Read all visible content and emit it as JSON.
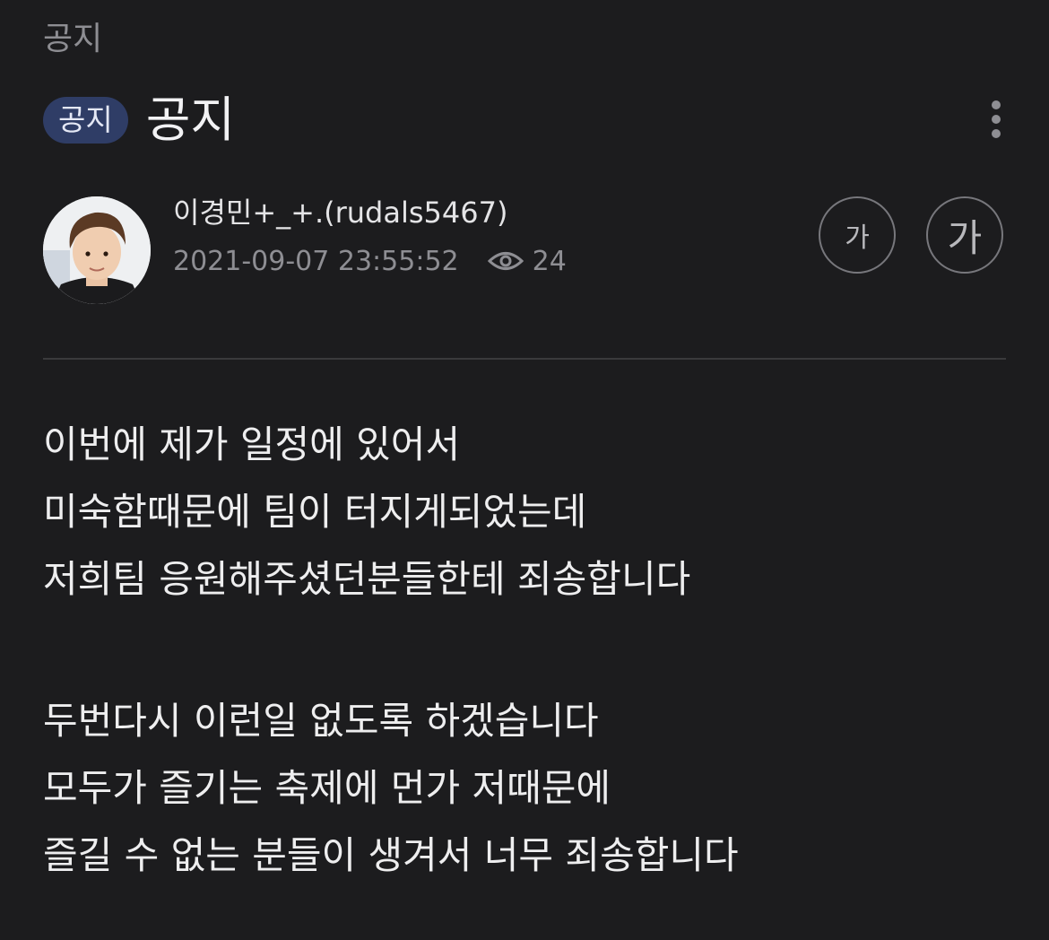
{
  "header": {
    "category": "공지"
  },
  "post": {
    "badge": "공지",
    "title": "공지",
    "author": "이경민+_+.(rudals5467)",
    "datetime": "2021-09-07 23:55:52",
    "views": "24"
  },
  "font_controls": {
    "smaller_label": "가",
    "larger_label": "가"
  },
  "body_paragraphs": [
    [
      "이번에 제가 일정에 있어서",
      "미숙함때문에 팀이 터지게되었는데",
      "저희팀 응원해주셨던분들한테 죄송합니다"
    ],
    [
      "두번다시 이런일 없도록 하겠습니다",
      "모두가 즐기는 축제에 먼가 저때문에",
      "즐길 수 없는 분들이 생겨서 너무 죄송합니다"
    ]
  ],
  "colors": {
    "background": "#1c1c1e",
    "badge_background": "#2f3d66",
    "muted_text": "#8e8e93"
  },
  "icons": [
    "more-vertical-icon",
    "eye-icon",
    "avatar-photo"
  ]
}
